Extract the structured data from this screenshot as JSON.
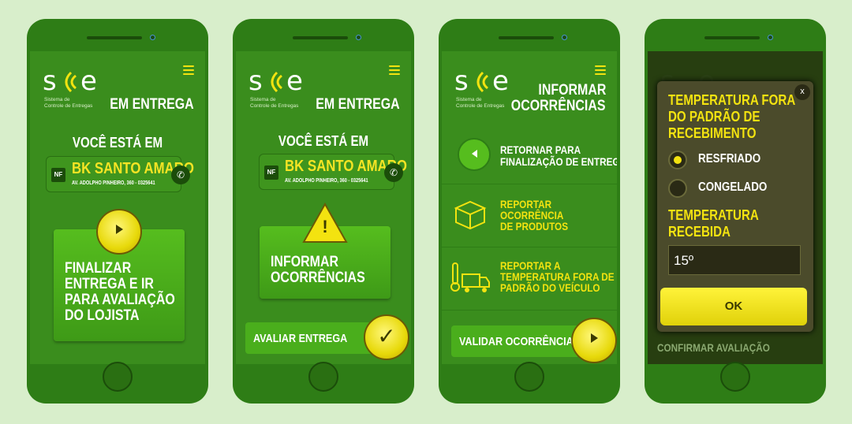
{
  "logo": {
    "s": "s",
    "e": "e",
    "sub1": "Sistema de",
    "sub2": "Controle de Entregas"
  },
  "p1": {
    "title": "EM ENTREGA",
    "you": "VOCÊ ESTÁ EM",
    "nf": "NF",
    "store": "BK SANTO AMARO",
    "addr": "AV. ADOLPHO PINHEIRO, 360 - 0325641",
    "card": [
      "FINALIZAR",
      "ENTREGA E IR",
      "PARA AVALIAÇÃO",
      "DO LOJISTA"
    ]
  },
  "p2": {
    "title": "EM ENTREGA",
    "you": "VOCÊ ESTÁ EM",
    "nf": "NF",
    "store": "BK SANTO AMARO",
    "addr": "AV. ADOLPHO PINHEIRO, 360 - 0325641",
    "warn": "!",
    "card": [
      "INFORMAR",
      "OCORRÊNCIAS"
    ],
    "bar": "AVALIAR ENTREGA",
    "check": "✓"
  },
  "p3": {
    "title": [
      "INFORMAR",
      "OCORRÊNCIAS"
    ],
    "back": [
      "RETORNAR PARA",
      "FINALIZAÇÃO DE ENTREGA"
    ],
    "r1": [
      "REPORTAR",
      "OCORRÊNCIA",
      "DE PRODUTOS"
    ],
    "r2": [
      "REPORTAR A",
      "TEMPERATURA FORA DE",
      "PADRÃO DO VEÍCULO"
    ],
    "bar": "VALIDAR OCORRÊNCIAS"
  },
  "p4": {
    "close": "x",
    "h1": [
      "TEMPERATURA FORA",
      "DO PADRÃO DE",
      "RECEBIMENTO"
    ],
    "opt1": "RESFRIADO",
    "opt2": "CONGELADO",
    "h2": [
      "TEMPERATURA",
      "RECEBIDA"
    ],
    "value": "15º",
    "ok": "OK",
    "behind": "CONFIRMAR AVALIAÇÃO"
  },
  "colors": {
    "bg": "#d8eecb",
    "phone": "#2e7d16",
    "screen": "#3a8d1d",
    "accent": "#f3e310",
    "button": "#e7d90a"
  },
  "icons": [
    "menu-icon",
    "phone-icon",
    "play-icon",
    "warning-icon",
    "check-icon",
    "back-arrow-icon",
    "box-icon",
    "truck-thermometer-icon",
    "close-icon",
    "radio-icon"
  ]
}
